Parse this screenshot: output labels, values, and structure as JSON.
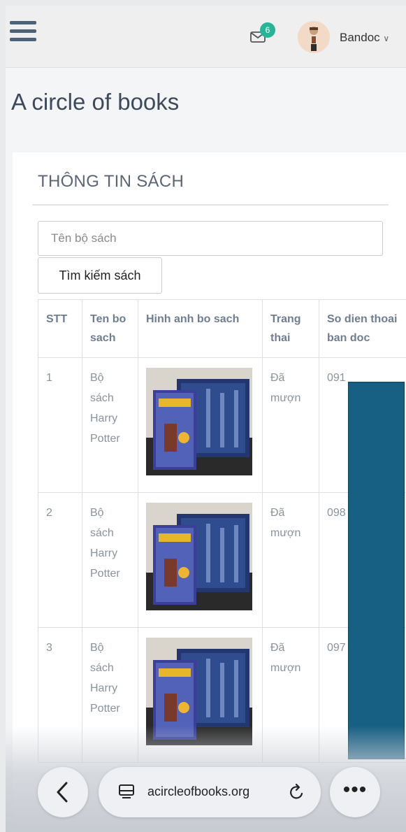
{
  "header": {
    "notification_count": "6",
    "username": "Bandoc"
  },
  "page_title": "A circle of books",
  "card": {
    "heading": "THÔNG TIN SÁCH",
    "search": {
      "placeholder": "Tên bộ sách",
      "value": ""
    },
    "search_button_label": "Tìm kiếm sách",
    "table": {
      "headers": [
        "STT",
        "Ten bo sach",
        "Hinh anh bo sach",
        "Trang thai",
        "So dien thoai ban doc"
      ],
      "rows": [
        {
          "stt": "1",
          "name": "Bộ sách Harry Potter",
          "status": "Đã mượn",
          "phone": "091"
        },
        {
          "stt": "2",
          "name": "Bộ sách Harry Potter",
          "status": "Đã mượn",
          "phone": "098"
        },
        {
          "stt": "3",
          "name": "Bộ sách Harry Potter",
          "status": "Đã mượn",
          "phone": "097"
        }
      ]
    }
  },
  "browser": {
    "url": "acircleofbooks.org"
  },
  "colors": {
    "accent_badge": "#27b59a",
    "redaction": "#175f83",
    "title": "#3d4a5c"
  }
}
